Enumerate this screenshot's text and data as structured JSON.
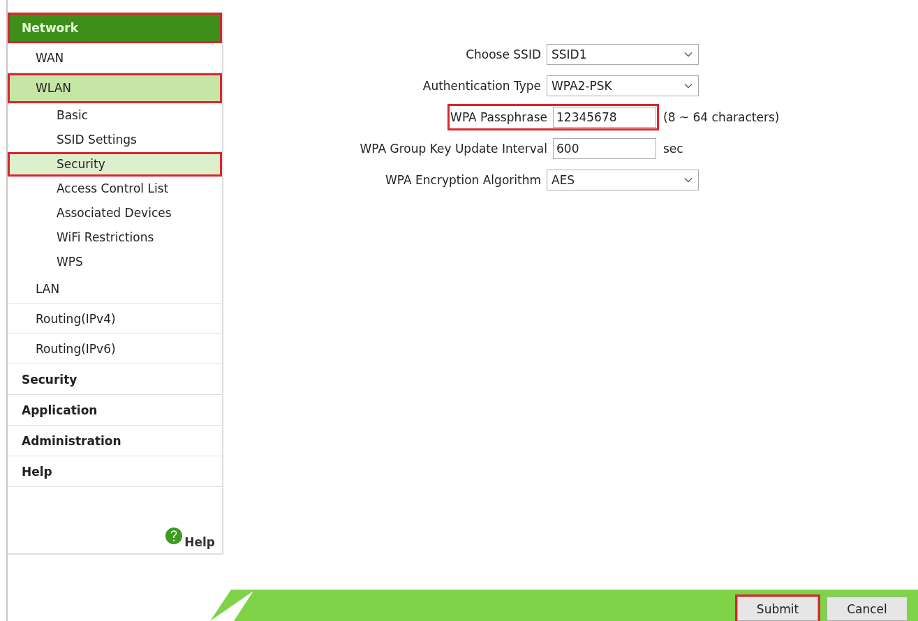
{
  "nav": [
    {
      "label": "Network",
      "selected": true,
      "highlighted": true,
      "children": [
        {
          "label": "WAN",
          "selected": false,
          "highlighted": false
        },
        {
          "label": "WLAN",
          "selected": true,
          "highlighted": true,
          "children": [
            {
              "label": "Basic",
              "selected": false,
              "highlighted": false
            },
            {
              "label": "SSID Settings",
              "selected": false,
              "highlighted": false
            },
            {
              "label": "Security",
              "selected": true,
              "highlighted": true
            },
            {
              "label": "Access Control List",
              "selected": false,
              "highlighted": false
            },
            {
              "label": "Associated Devices",
              "selected": false,
              "highlighted": false
            },
            {
              "label": "WiFi Restrictions",
              "selected": false,
              "highlighted": false
            },
            {
              "label": "WPS",
              "selected": false,
              "highlighted": false
            }
          ]
        },
        {
          "label": "LAN",
          "selected": false,
          "highlighted": false
        },
        {
          "label": "Routing(IPv4)",
          "selected": false,
          "highlighted": false
        },
        {
          "label": "Routing(IPv6)",
          "selected": false,
          "highlighted": false
        }
      ]
    },
    {
      "label": "Security",
      "selected": false,
      "highlighted": false
    },
    {
      "label": "Application",
      "selected": false,
      "highlighted": false
    },
    {
      "label": "Administration",
      "selected": false,
      "highlighted": false
    },
    {
      "label": "Help",
      "selected": false,
      "highlighted": false
    }
  ],
  "help_link": "Help",
  "form": [
    {
      "label": "Choose SSID",
      "kind": "select",
      "value": "SSID1",
      "highlighted": false
    },
    {
      "label": "Authentication Type",
      "kind": "select",
      "value": "WPA2-PSK",
      "highlighted": false
    },
    {
      "label": "WPA Passphrase",
      "kind": "input",
      "value": "12345678",
      "note": "(8 ~ 64 characters)",
      "highlighted": true
    },
    {
      "label": "WPA Group Key Update Interval",
      "kind": "input",
      "value": "600",
      "note": "sec",
      "highlighted": false
    },
    {
      "label": "WPA Encryption Algorithm",
      "kind": "select",
      "value": "AES",
      "highlighted": false
    }
  ],
  "buttons": [
    {
      "label": "Submit",
      "highlighted": true
    },
    {
      "label": "Cancel",
      "highlighted": false
    }
  ]
}
